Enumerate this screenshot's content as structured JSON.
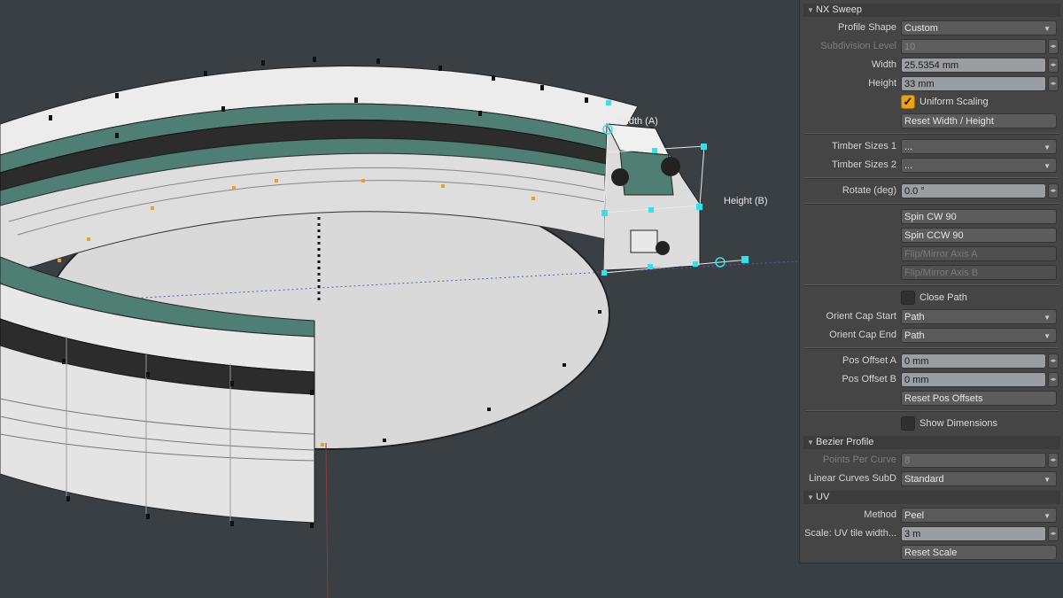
{
  "viewport": {
    "labels": {
      "width_label": "Width (A)",
      "height_label": "Height (B)"
    }
  },
  "panel": {
    "sections": {
      "nx_sweep": "NX Sweep",
      "bezier_profile": "Bezier Profile",
      "uv": "UV"
    },
    "profile_shape": {
      "label": "Profile Shape",
      "value": "Custom"
    },
    "subdivision_level": {
      "label": "Subdivision Level",
      "value": "10"
    },
    "width": {
      "label": "Width",
      "value": "25.5354 mm"
    },
    "height": {
      "label": "Height",
      "value": "33 mm"
    },
    "uniform_scaling": {
      "label": "Uniform Scaling",
      "checked": true
    },
    "reset_width_height": "Reset Width / Height",
    "timber_sizes_1": {
      "label": "Timber Sizes 1",
      "value": "..."
    },
    "timber_sizes_2": {
      "label": "Timber Sizes 2",
      "value": "..."
    },
    "rotate": {
      "label": "Rotate (deg)",
      "value": "0.0 °"
    },
    "spin_cw": "Spin CW 90",
    "spin_ccw": "Spin CCW 90",
    "flip_a": "Flip/Mirror Axis A",
    "flip_b": "Flip/Mirror Axis B",
    "close_path": {
      "label": "Close Path",
      "checked": false
    },
    "orient_cap_start": {
      "label": "Orient Cap Start",
      "value": "Path"
    },
    "orient_cap_end": {
      "label": "Orient Cap End",
      "value": "Path"
    },
    "pos_offset_a": {
      "label": "Pos Offset A",
      "value": "0 mm"
    },
    "pos_offset_b": {
      "label": "Pos Offset B",
      "value": "0 mm"
    },
    "reset_pos_offsets": "Reset Pos Offsets",
    "show_dimensions": {
      "label": "Show Dimensions",
      "checked": false
    },
    "points_per_curve": {
      "label": "Points Per Curve",
      "value": "8"
    },
    "linear_curves_subd": {
      "label": "Linear Curves SubD",
      "value": "Standard"
    },
    "method": {
      "label": "Method",
      "value": "Peel"
    },
    "scale_uv": {
      "label": "Scale: UV tile width...",
      "value": "3 m"
    },
    "reset_scale": "Reset Scale"
  },
  "colors": {
    "background": "#3a3f44",
    "panel": "#454545",
    "accent": "#e8a21d",
    "handle": "#2de3f0",
    "wood_light": "#e6e6e6",
    "wood_green": "#4f7f72",
    "wood_dark": "#2c2c2c"
  }
}
